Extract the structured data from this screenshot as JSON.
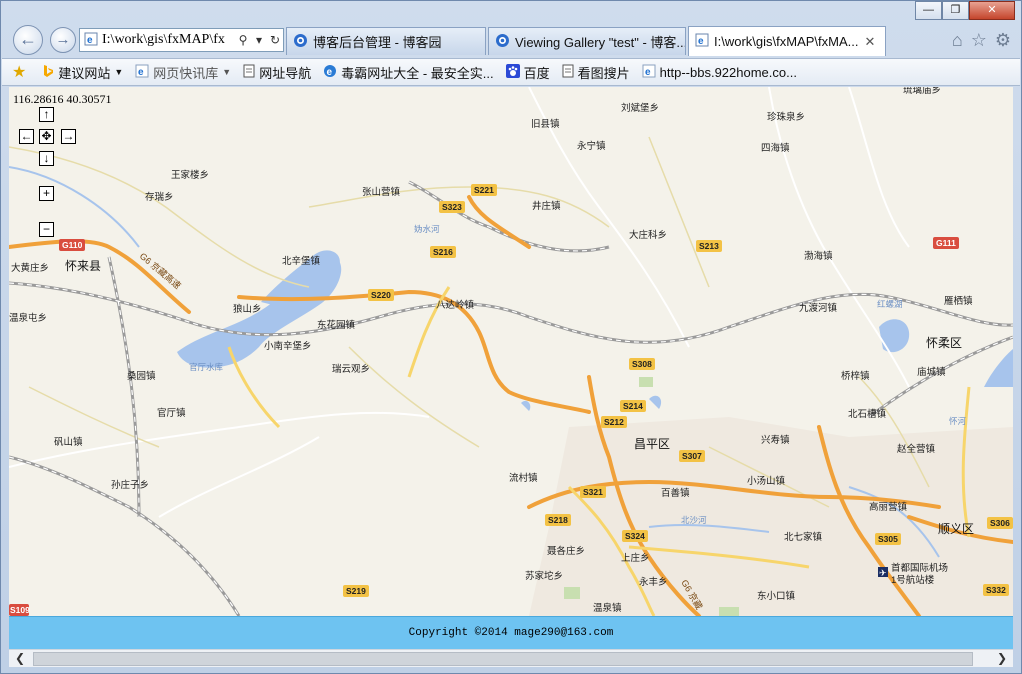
{
  "window": {
    "minimize_glyph": "—",
    "restore_glyph": "❐",
    "close_glyph": "✕"
  },
  "nav": {
    "back_glyph": "←",
    "forward_glyph": "→",
    "address_value": "I:\\work\\gis\\fxMAP\\fx",
    "search_glyph": "⚲",
    "dropdown_glyph": "▾",
    "refresh_glyph": "↻"
  },
  "tabs": [
    {
      "label": "博客后台管理 - 博客园",
      "active": false
    },
    {
      "label": "Viewing Gallery \"test\" - 博客...",
      "active": false
    },
    {
      "label": "I:\\work\\gis\\fxMAP\\fxMA...",
      "active": true,
      "close": "✕"
    }
  ],
  "toolbar_icons": {
    "home": "⌂",
    "favorites": "☆",
    "settings": "⚙"
  },
  "favorites": {
    "star": "★",
    "items": [
      {
        "label": "建议网站",
        "icon": "b-icon",
        "dropdown": "▼"
      },
      {
        "label": "网页快讯库",
        "icon": "feed-icon",
        "dropdown": "▼"
      },
      {
        "label": "网址导航",
        "icon": "page-icon"
      },
      {
        "label": "毒霸网址大全 - 最安全实...",
        "icon": "ie-icon"
      },
      {
        "label": "百度",
        "icon": "paw-icon"
      },
      {
        "label": "看图搜片",
        "icon": "page-icon"
      },
      {
        "label": "http--bbs.922home.co...",
        "icon": "ie-icon"
      }
    ]
  },
  "map": {
    "coordinates": "116.28616 40.30571",
    "controls": {
      "up": "↑",
      "left": "←",
      "center": "✥",
      "right": "→",
      "down": "↓",
      "zoom_in": "+",
      "zoom_out": "−"
    },
    "towns": [
      "刘斌堡乡",
      "琉璃庙乡",
      "旧县镇",
      "珍珠泉乡",
      "永宁镇",
      "四海镇",
      "王家楼乡",
      "张山营镇",
      "存瑞乡",
      "井庄镇",
      "大庄科乡",
      "汤河口镇",
      "北辛堡镇",
      "渤海镇",
      "大黄庄乡",
      "怀来县",
      "狼山乡",
      "八达岭镇",
      "东花园镇",
      "九渡河镇",
      "雁栖镇",
      "温泉屯乡",
      "小南辛堡乡",
      "怀柔区",
      "桑园镇",
      "瑞云观乡",
      "桥梓镇",
      "庙城镇",
      "官厅镇",
      "北石槽镇",
      "兴寿镇",
      "昌平区",
      "赵全营镇",
      "矾山镇",
      "流村镇",
      "小汤山镇",
      "孙庄子乡",
      "百善镇",
      "高丽营镇",
      "顺义区",
      "北七家镇",
      "聂各庄乡",
      "上庄乡",
      "苏家坨乡",
      "永丰乡",
      "东小口镇",
      "温泉镇",
      "首都国际机场",
      "1号航站楼",
      "红螺湖",
      "官厅水库",
      "北沙河",
      "怀河",
      "妫水河"
    ],
    "road_shields": [
      "G110",
      "S323",
      "S221",
      "S216",
      "S213",
      "G111",
      "S220",
      "S308",
      "S214",
      "S212",
      "S307",
      "S321",
      "S218",
      "S324",
      "S305",
      "S306",
      "S332",
      "S219",
      "G6 京藏高速",
      "S109"
    ]
  },
  "footer": {
    "copyright": "Copyright ©2014 mage290@163.com"
  },
  "scrollbar": {
    "left": "❮",
    "right": "❯"
  }
}
